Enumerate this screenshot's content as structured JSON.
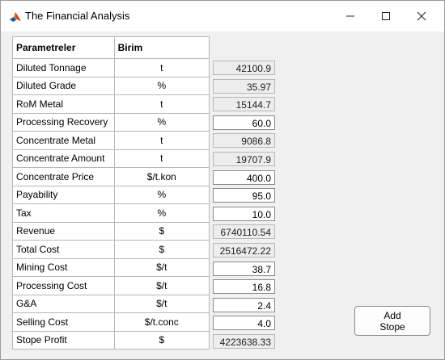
{
  "window": {
    "title": "The Financial Analysis",
    "icon": "matlab-icon",
    "controls": [
      "minimize-icon",
      "maximize-icon",
      "close-icon"
    ]
  },
  "table": {
    "headers": [
      "Parametreler",
      "Birim"
    ],
    "rows": [
      {
        "param": "Diluted Tonnage",
        "unit": "t",
        "value": "42100.9",
        "editable": false
      },
      {
        "param": "Diluted Grade",
        "unit": "%",
        "value": "35.97",
        "editable": false
      },
      {
        "param": "RoM Metal",
        "unit": "t",
        "value": "15144.7",
        "editable": false
      },
      {
        "param": "Processing Recovery",
        "unit": "%",
        "value": "60.0",
        "editable": true
      },
      {
        "param": "Concentrate Metal",
        "unit": "t",
        "value": "9086.8",
        "editable": false
      },
      {
        "param": "Concentrate Amount",
        "unit": "t",
        "value": "19707.9",
        "editable": false
      },
      {
        "param": "Concentrate Price",
        "unit": "$/t.kon",
        "value": "400.0",
        "editable": true
      },
      {
        "param": "Payability",
        "unit": "%",
        "value": "95.0",
        "editable": true
      },
      {
        "param": "Tax",
        "unit": "%",
        "value": "10.0",
        "editable": true
      },
      {
        "param": "Revenue",
        "unit": "$",
        "value": "6740110.54",
        "editable": false
      },
      {
        "param": "Total Cost",
        "unit": "$",
        "value": "2516472.22",
        "editable": false
      },
      {
        "param": "Mining Cost",
        "unit": "$/t",
        "value": "38.7",
        "editable": true
      },
      {
        "param": "Processing Cost",
        "unit": "$/t",
        "value": "16.8",
        "editable": true
      },
      {
        "param": "G&A",
        "unit": "$/t",
        "value": "2.4",
        "editable": true
      },
      {
        "param": "Selling Cost",
        "unit": "$/t.conc",
        "value": "4.0",
        "editable": true
      },
      {
        "param": "Stope Profit",
        "unit": "$",
        "value": "4223638.33",
        "editable": false
      }
    ]
  },
  "buttons": {
    "add_stope": "Add\nStope"
  }
}
